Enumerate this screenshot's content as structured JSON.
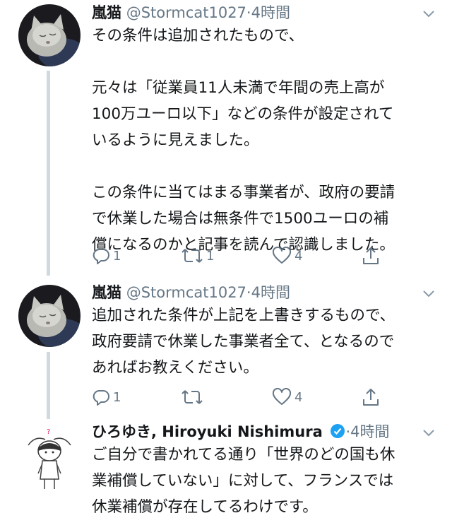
{
  "tweets": [
    {
      "name": "嵐猫",
      "handle": "@Stormcat1027",
      "sep": "·",
      "time": "4時間",
      "text": "その条件は追加されたもので、\n\n元々は「従業員11人未満で年間の売上高が\n100万ユーロ以下」などの条件が設定されて\nいるように見えました。\n\nこの条件に当てはまる事業者が、政府の要請\nで休業した場合は無条件で1500ユーロの補\n償になるのかと記事を読んで認識しました。",
      "reply_count": "1",
      "retweet_count": "1",
      "like_count": "4"
    },
    {
      "name": "嵐猫",
      "handle": "@Stormcat1027",
      "sep": "·",
      "time": "4時間",
      "text": "追加された条件が上記を上書きするもので、\n政府要請で休業した事業者全て、となるので\nあればお教えください。",
      "reply_count": "1",
      "retweet_count": "",
      "like_count": "4"
    },
    {
      "name": "ひろゆき, Hiroyuki Nishimura",
      "handle": "",
      "sep": "·",
      "time": "4時間",
      "text": "ご自分で書かれてる通り「世界のどの国も休\n業補償していない」に対して、フランスでは\n休業補償が存在してるわけです。",
      "verified": true
    }
  ],
  "colors": {
    "text": "#14171a",
    "muted": "#657786",
    "line": "#cfd9de",
    "verified": "#1da1f2"
  },
  "icons": [
    "reply-icon",
    "retweet-icon",
    "like-icon",
    "share-icon",
    "chevron-down-icon",
    "verified-badge-icon"
  ]
}
